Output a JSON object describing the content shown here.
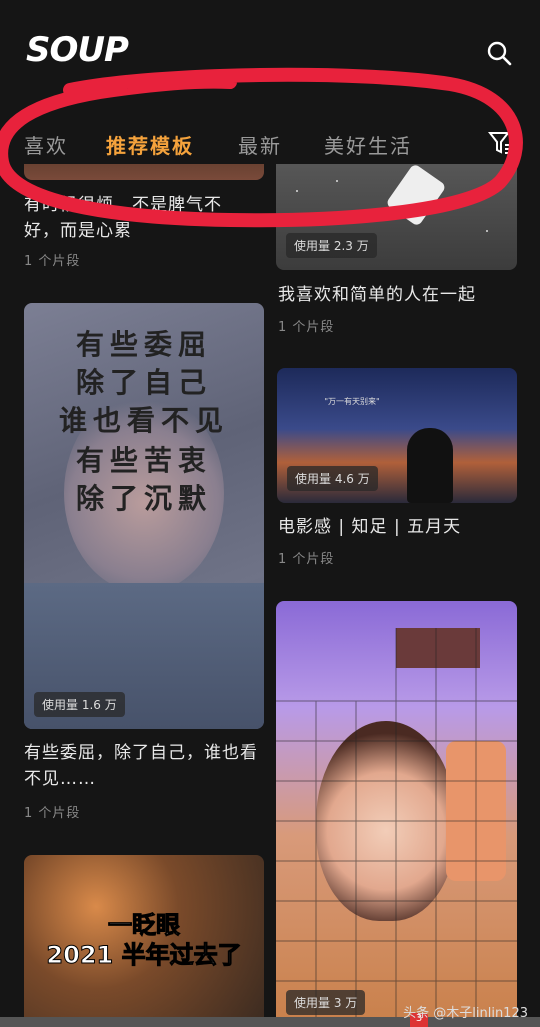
{
  "header": {
    "logo": "SOUP",
    "search_icon": "search-icon"
  },
  "tabs": [
    {
      "label": "喜欢",
      "active": false
    },
    {
      "label": "推荐模板",
      "active": true
    },
    {
      "label": "最新",
      "active": false
    },
    {
      "label": "美好生活",
      "active": false
    }
  ],
  "filter_icon": "filter-icon",
  "left_column": [
    {
      "title": "有时候很烦，不是脾气不好，而是心累",
      "clips": "1 个片段"
    },
    {
      "usage": "使用量 1.6 万",
      "title": "有些委屈，除了自己，谁也看不见……",
      "clips": "1 个片段",
      "overlay": [
        "有些委屈",
        "除了自己",
        "谁也看不见",
        "有些苦衷",
        "除了沉默"
      ]
    },
    {
      "overlay": [
        "一眨眼",
        "2021 半年过去了"
      ]
    }
  ],
  "right_column": [
    {
      "usage": "使用量 2.3 万",
      "title": "我喜欢和简单的人在一起",
      "clips": "1 个片段"
    },
    {
      "usage": "使用量 4.6 万",
      "title": "电影感 | 知足 | 五月天",
      "clips": "1 个片段",
      "caption": "\"万一有天别来\""
    },
    {
      "usage": "使用量 3 万"
    }
  ],
  "watermark": "头条 @木子linlin123",
  "badge": "3",
  "colors": {
    "accent": "#f4a23c",
    "annotation": "#e8223c",
    "background": "#151515"
  }
}
